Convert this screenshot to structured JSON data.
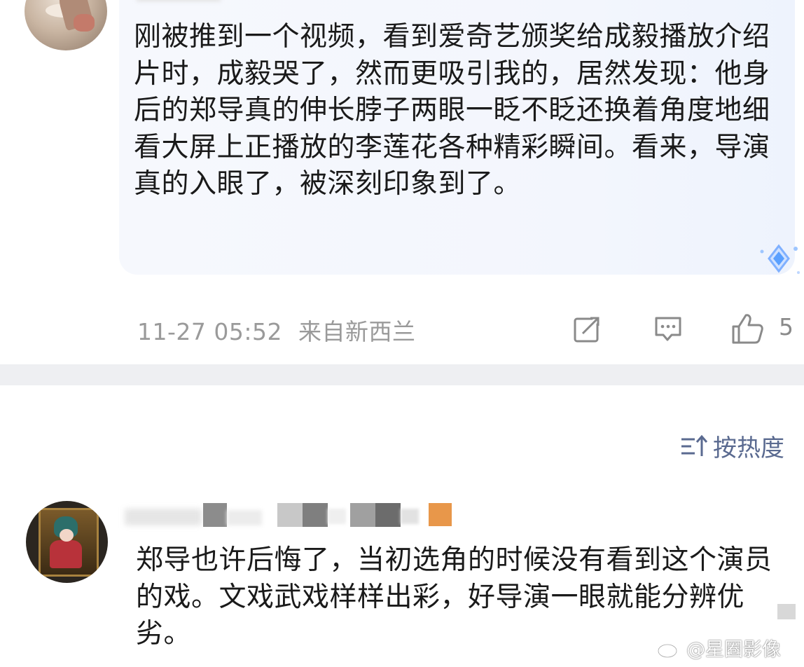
{
  "comment1": {
    "text": "刚被推到一个视频，看到爱奇艺颁奖给成毅播放介绍片时，成毅哭了，然而更吸引我的，居然发现：他身后的郑导真的伸长脖子两眼一眨不眨还换着角度地细看大屏上正播放的李莲花各种精彩瞬间。看来，导演真的入眼了，被深刻印象到了。",
    "timestamp": "11-27 05:52",
    "location": "来自新西兰",
    "like_count": "5",
    "icons": {
      "share": "share-icon",
      "reply": "comment-icon",
      "like": "thumbs-up-icon"
    }
  },
  "sort": {
    "label": "按热度",
    "icon": "sort-icon"
  },
  "comment2": {
    "text": "郑导也许后悔了，当初选角的时候没有看到这个演员的戏。文戏武戏样样出彩，好导演一眼就能分辨优劣。"
  },
  "watermark": {
    "text": "@星圈影像",
    "icon": "weibo-logo-icon"
  },
  "colors": {
    "bubble": "#f3f6fd",
    "meta_text": "#9a9a9a",
    "sort_text": "#5a6a90",
    "divider": "#eeeff2",
    "badge_orange": "#e8974a"
  }
}
